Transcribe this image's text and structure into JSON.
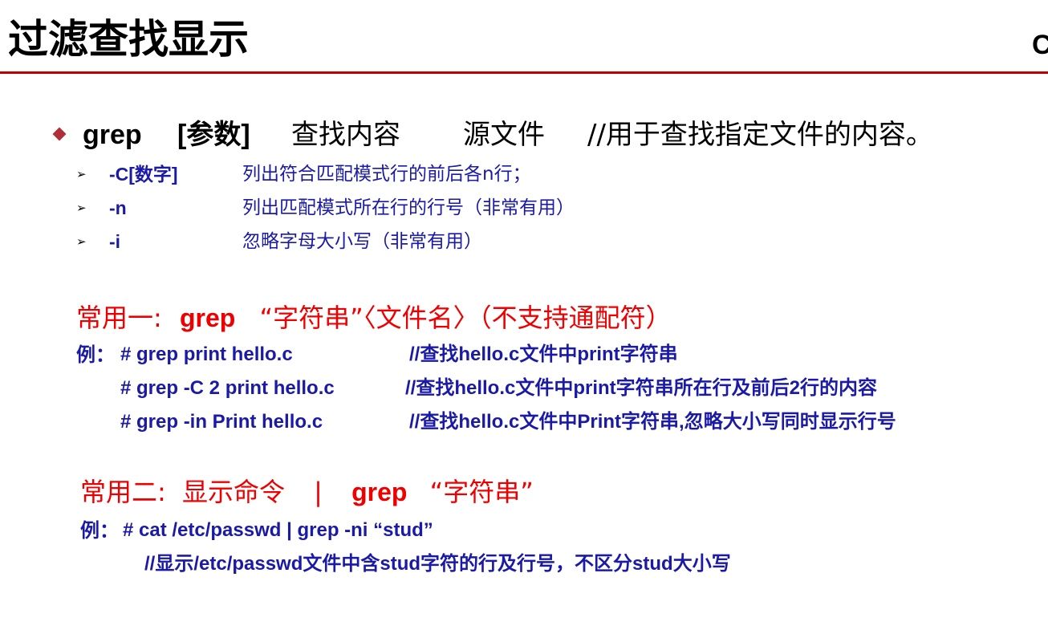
{
  "header": {
    "title": "过滤查找显示",
    "corner_text": "C"
  },
  "main": {
    "command": "grep",
    "param": "[参数]",
    "search": "查找内容",
    "source": "源文件",
    "comment": "//用于查找指定文件的内容。"
  },
  "options": [
    {
      "flag": "-C[数字]",
      "desc": "列出符合匹配模式行的前后各n行；"
    },
    {
      "flag": "-n",
      "desc": "列出匹配模式所在行的行号（非常有用）"
    },
    {
      "flag": "-i",
      "desc": "忽略字母大小写（非常有用）"
    }
  ],
  "usage1": {
    "label": "常用一:",
    "cmd": "grep",
    "rest": "“字符串”〈文件名〉（不支持通配符）",
    "examples": [
      {
        "prefix": "例：",
        "cmd": "# grep  print  hello.c",
        "comment": "//查找hello.c文件中print字符串"
      },
      {
        "prefix": "",
        "cmd": "# grep -C 2 print  hello.c",
        "comment": "//查找hello.c文件中print字符串所在行及前后2行的内容"
      },
      {
        "prefix": "",
        "cmd": "# grep -in Print  hello.c",
        "comment": "//查找hello.c文件中Print字符串,忽略大小写同时显示行号"
      }
    ]
  },
  "usage2": {
    "label": "常用二:",
    "text": "显示命令",
    "pipe": "|",
    "cmd": "grep",
    "rest": "“字符串”",
    "example": {
      "prefix": "例：",
      "cmd": "# cat  /etc/passwd  | grep  -ni “stud”",
      "comment": "//显示/etc/passwd文件中含stud字符的行及行号，不区分stud大小写"
    }
  },
  "colors": {
    "accent_red": "#ee0000",
    "rule": "#c00000",
    "text_blue": "#1a1aa6",
    "bullet": "#b0303a"
  }
}
